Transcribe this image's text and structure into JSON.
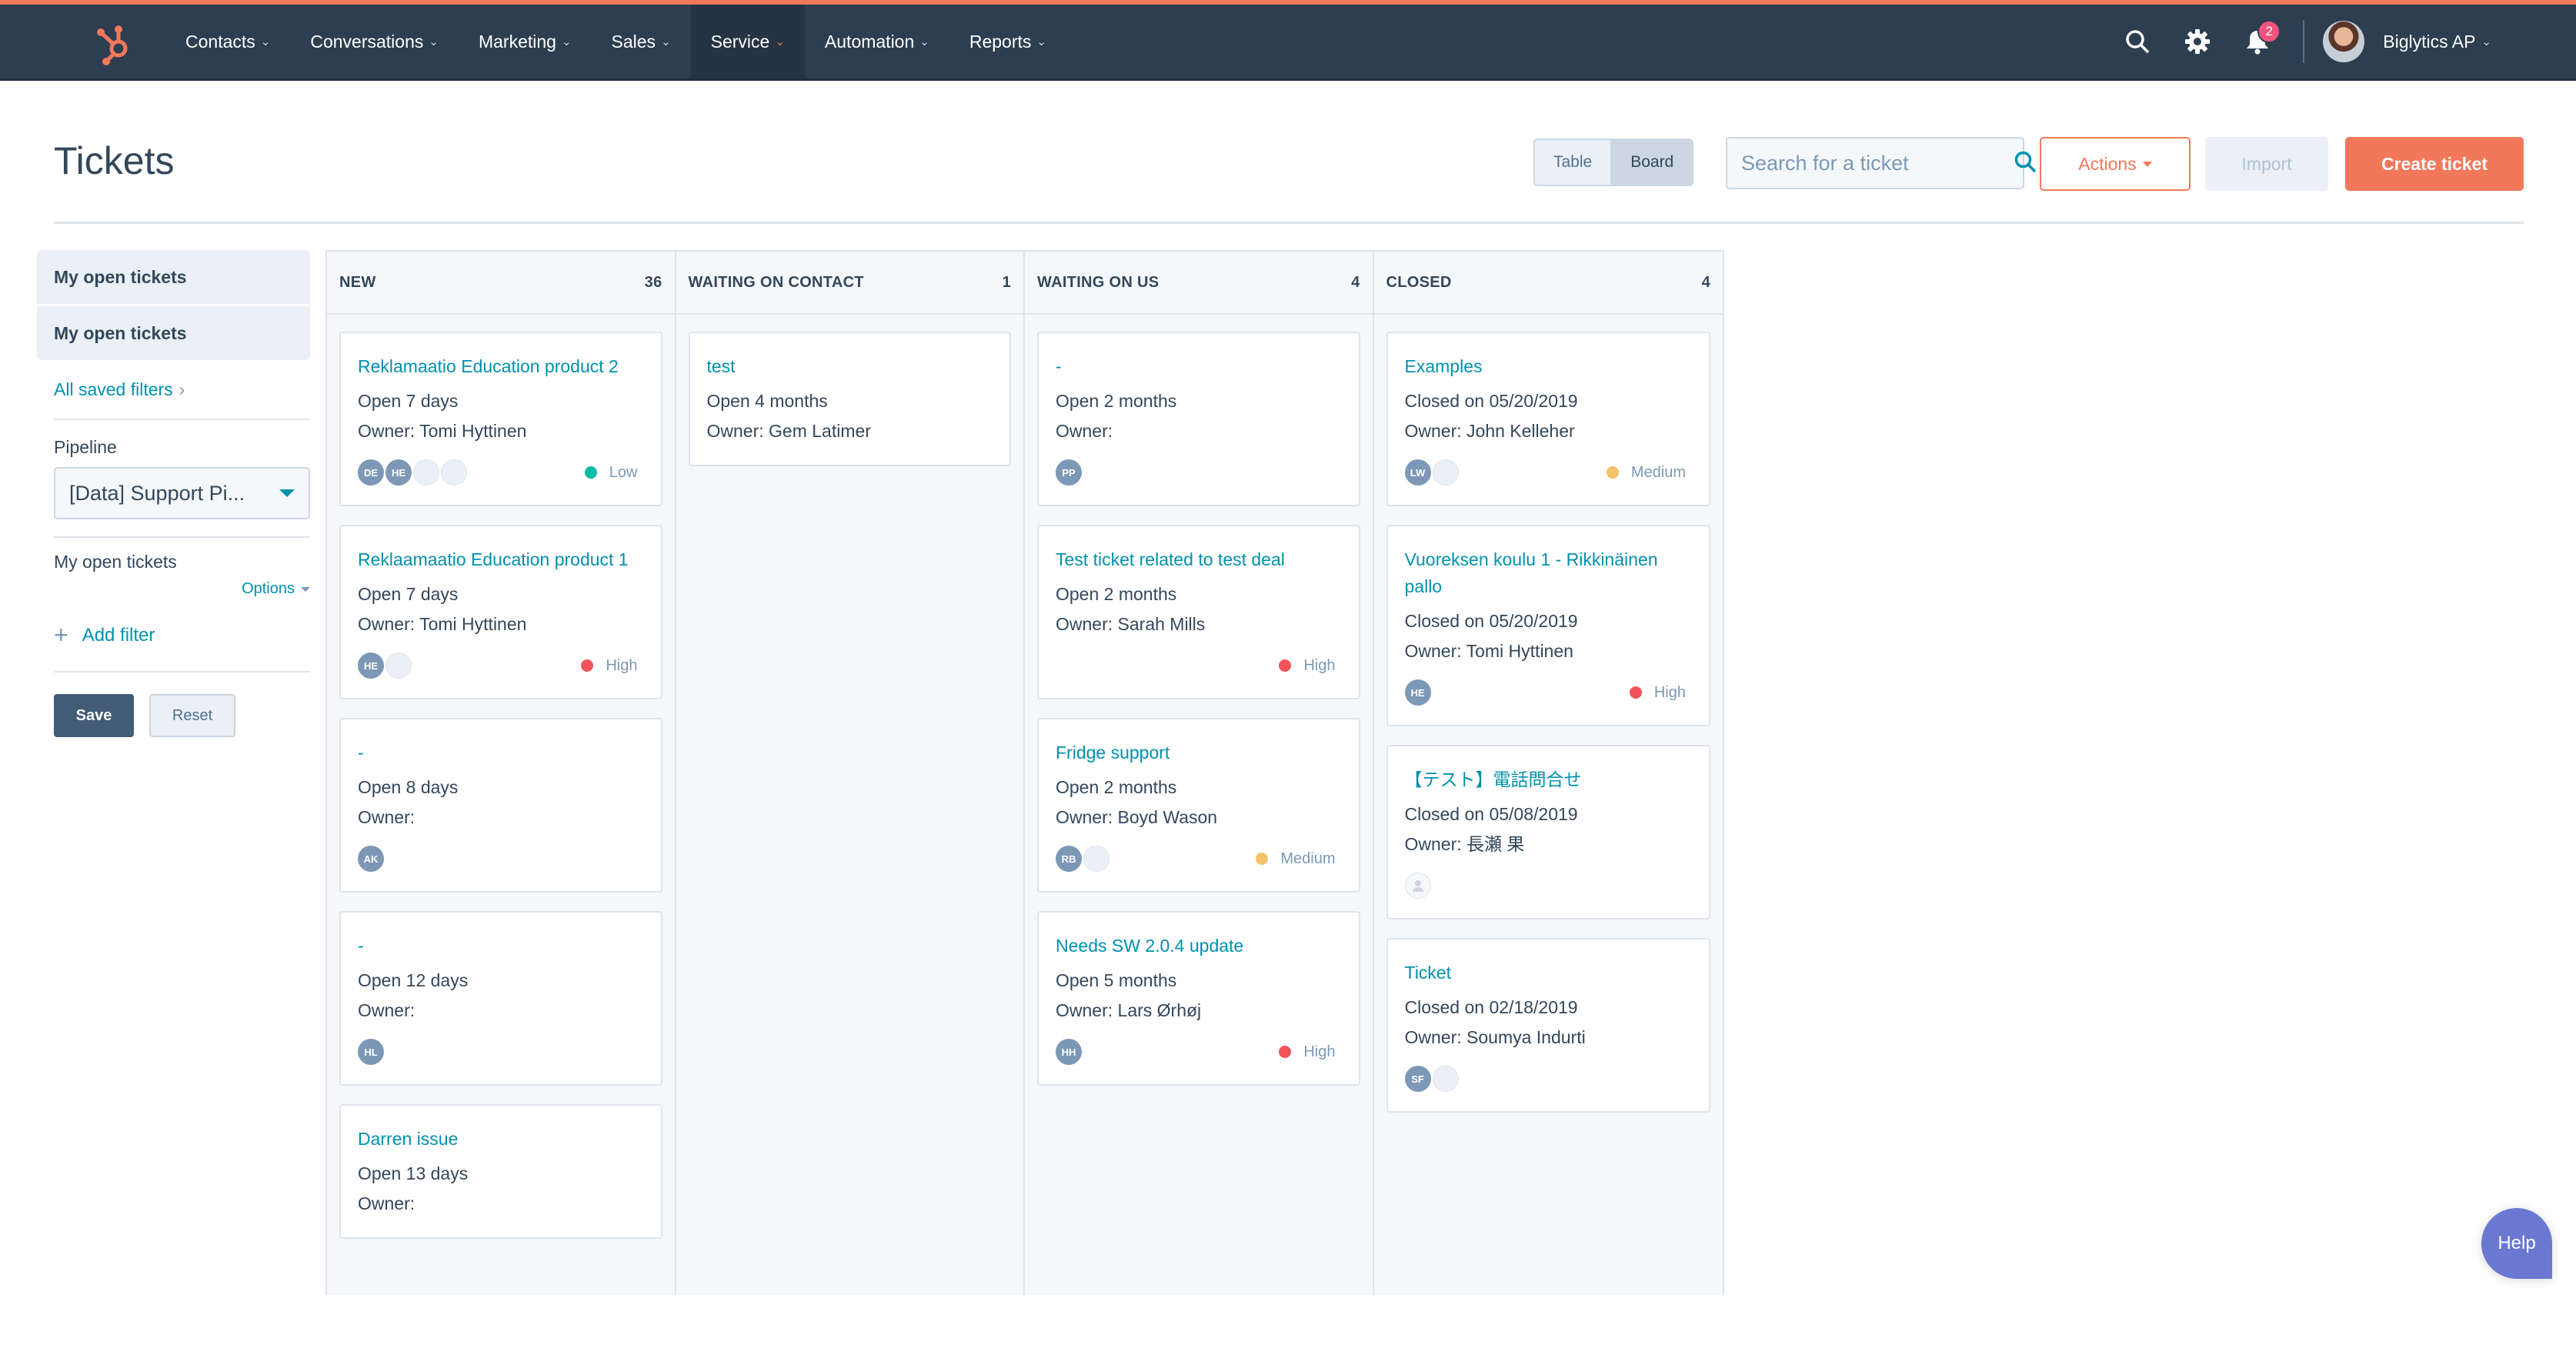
{
  "topnav": {
    "logo": "hubspot-sprocket-icon",
    "items": [
      {
        "label": "Contacts",
        "active": false
      },
      {
        "label": "Conversations",
        "active": false
      },
      {
        "label": "Marketing",
        "active": false
      },
      {
        "label": "Sales",
        "active": false
      },
      {
        "label": "Service",
        "active": true
      },
      {
        "label": "Automation",
        "active": false
      },
      {
        "label": "Reports",
        "active": false
      }
    ],
    "notification_count": "2",
    "account_name": "Biglytics AP",
    "accent": "#f2785c"
  },
  "header": {
    "title": "Tickets",
    "view_toggle": {
      "table": "Table",
      "board": "Board",
      "selected": "Board"
    },
    "search_placeholder": "Search for a ticket",
    "actions_label": "Actions",
    "import_label": "Import",
    "create_label": "Create ticket"
  },
  "sidebar": {
    "views": [
      "My open tickets",
      "My open tickets"
    ],
    "all_saved_filters": "All saved filters",
    "pipeline_label": "Pipeline",
    "pipeline_value": "[Data] Support Pi...",
    "filter_title": "My open tickets",
    "options_label": "Options",
    "add_filter_label": "Add filter",
    "save_label": "Save",
    "reset_label": "Reset"
  },
  "priority_colors": {
    "Low": "#00bda5",
    "Medium": "#f5c26b",
    "High": "#f2545b"
  },
  "board": {
    "columns": [
      {
        "name": "NEW",
        "count": "36",
        "cards": [
          {
            "title": "Reklamaatio Education product 2",
            "status": "Open 7 days",
            "owner": "Owner: Tomi Hyttinen",
            "avatars": [
              "DE",
              "HE",
              "",
              ""
            ],
            "priority": "Low"
          },
          {
            "title": "Reklaamaatio Education product 1",
            "status": "Open 7 days",
            "owner": "Owner: Tomi Hyttinen",
            "avatars": [
              "HE",
              ""
            ],
            "priority": "High"
          },
          {
            "title": "-",
            "status": "Open 8 days",
            "owner": "Owner:",
            "avatars": [
              "AK"
            ],
            "priority": ""
          },
          {
            "title": "-",
            "status": "Open 12 days",
            "owner": "Owner:",
            "avatars": [
              "HL"
            ],
            "priority": ""
          },
          {
            "title": "Darren issue",
            "status": "Open 13 days",
            "owner": "Owner:",
            "avatars": [],
            "priority": ""
          }
        ]
      },
      {
        "name": "WAITING ON CONTACT",
        "count": "1",
        "cards": [
          {
            "title": "test",
            "status": "Open 4 months",
            "owner": "Owner: Gem Latimer",
            "avatars": [],
            "priority": ""
          }
        ]
      },
      {
        "name": "WAITING ON US",
        "count": "4",
        "cards": [
          {
            "title": "-",
            "status": "Open 2 months",
            "owner": "Owner:",
            "avatars": [
              "PP"
            ],
            "priority": ""
          },
          {
            "title": "Test ticket related to test deal",
            "status": "Open 2 months",
            "owner": "Owner: Sarah Mills",
            "avatars": [],
            "priority": "High"
          },
          {
            "title": "Fridge support",
            "status": "Open 2 months",
            "owner": "Owner: Boyd Wason",
            "avatars": [
              "RB",
              ""
            ],
            "priority": "Medium"
          },
          {
            "title": "Needs SW 2.0.4 update",
            "status": "Open 5 months",
            "owner": "Owner: Lars Ørhøj",
            "avatars": [
              "HH"
            ],
            "priority": "High"
          }
        ]
      },
      {
        "name": "CLOSED",
        "count": "4",
        "cards": [
          {
            "title": "Examples",
            "status": "Closed on 05/20/2019",
            "owner": "Owner: John Kelleher",
            "avatars": [
              "LW",
              ""
            ],
            "priority": "Medium"
          },
          {
            "title": "Vuoreksen koulu 1 - Rikkinäinen pallo",
            "status": "Closed on 05/20/2019",
            "owner": "Owner: Tomi Hyttinen",
            "avatars": [
              "HE"
            ],
            "priority": "High"
          },
          {
            "title": "【テスト】電話問合せ",
            "status": "Closed on 05/08/2019",
            "owner": "Owner: 長瀬 果",
            "avatars": [
              "@person"
            ],
            "priority": ""
          },
          {
            "title": "Ticket",
            "status": "Closed on 02/18/2019",
            "owner": "Owner: Soumya Indurti",
            "avatars": [
              "SF",
              ""
            ],
            "priority": ""
          }
        ]
      }
    ]
  },
  "help_label": "Help"
}
